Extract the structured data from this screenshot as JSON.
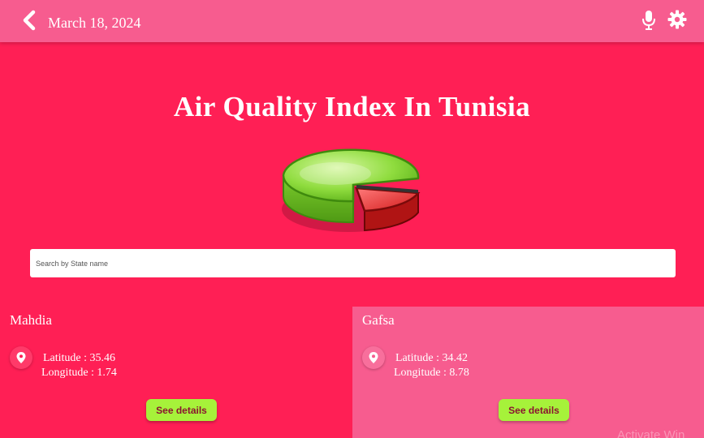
{
  "header": {
    "date": "March 18, 2024",
    "icons": [
      "chevron-left-icon",
      "microphone-icon",
      "gear-icon"
    ]
  },
  "main": {
    "title": "Air Quality Index In Tunisia",
    "logo_icon": "pie-chart-icon",
    "search": {
      "placeholder": "Search by State name",
      "value": ""
    }
  },
  "cards": [
    {
      "name": "Mahdia",
      "latitude_text": "Latitude : 35.46",
      "longitude_text": "Longitude : 1.74",
      "button_label": "See details"
    },
    {
      "name": "Gafsa",
      "latitude_text": "Latitude : 34.42",
      "longitude_text": "Longitude : 8.78",
      "button_label": "See details"
    }
  ],
  "overlay": {
    "watermark": "Activate Win"
  },
  "colors": {
    "background": "#ff1f55",
    "header": "#f75c8f",
    "button": "#a6f23a",
    "button_text": "#8a1530"
  }
}
